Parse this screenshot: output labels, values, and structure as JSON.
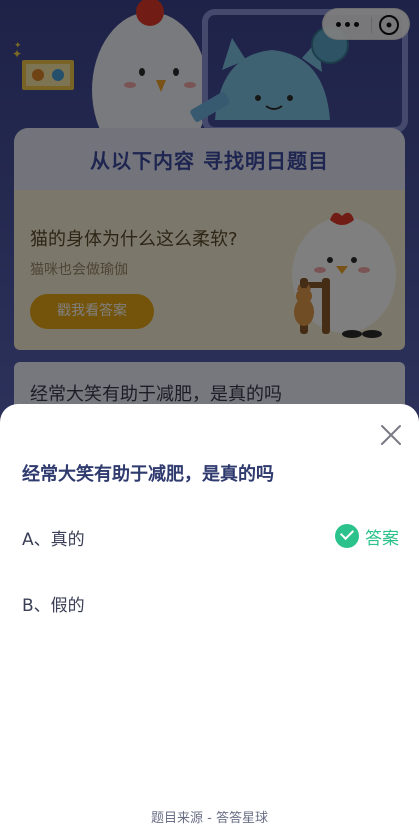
{
  "background": {
    "banner_title": "从以下内容  寻找明日题目",
    "card1": {
      "question": "猫的身体为什么这么柔软?",
      "subtitle": "猫咪也会做瑜伽",
      "button_label": "戳我看答案"
    },
    "card2": {
      "question": "经常大笑有助于减肥，是真的吗"
    }
  },
  "capsule": {
    "more_icon": "more-dots-icon",
    "close_icon": "close-circle-icon"
  },
  "sheet": {
    "question": "经常大笑有助于减肥，是真的吗",
    "options": [
      {
        "label": "A、真的",
        "is_answer": true
      },
      {
        "label": "B、假的",
        "is_answer": false
      }
    ],
    "answer_label": "答案",
    "source": "题目来源 - 答答星球"
  },
  "colors": {
    "accent_green": "#2cc28b",
    "question_color": "#2f3a6e",
    "banner_title_color": "#3d4aa1",
    "button_gold": "#e8a914"
  }
}
